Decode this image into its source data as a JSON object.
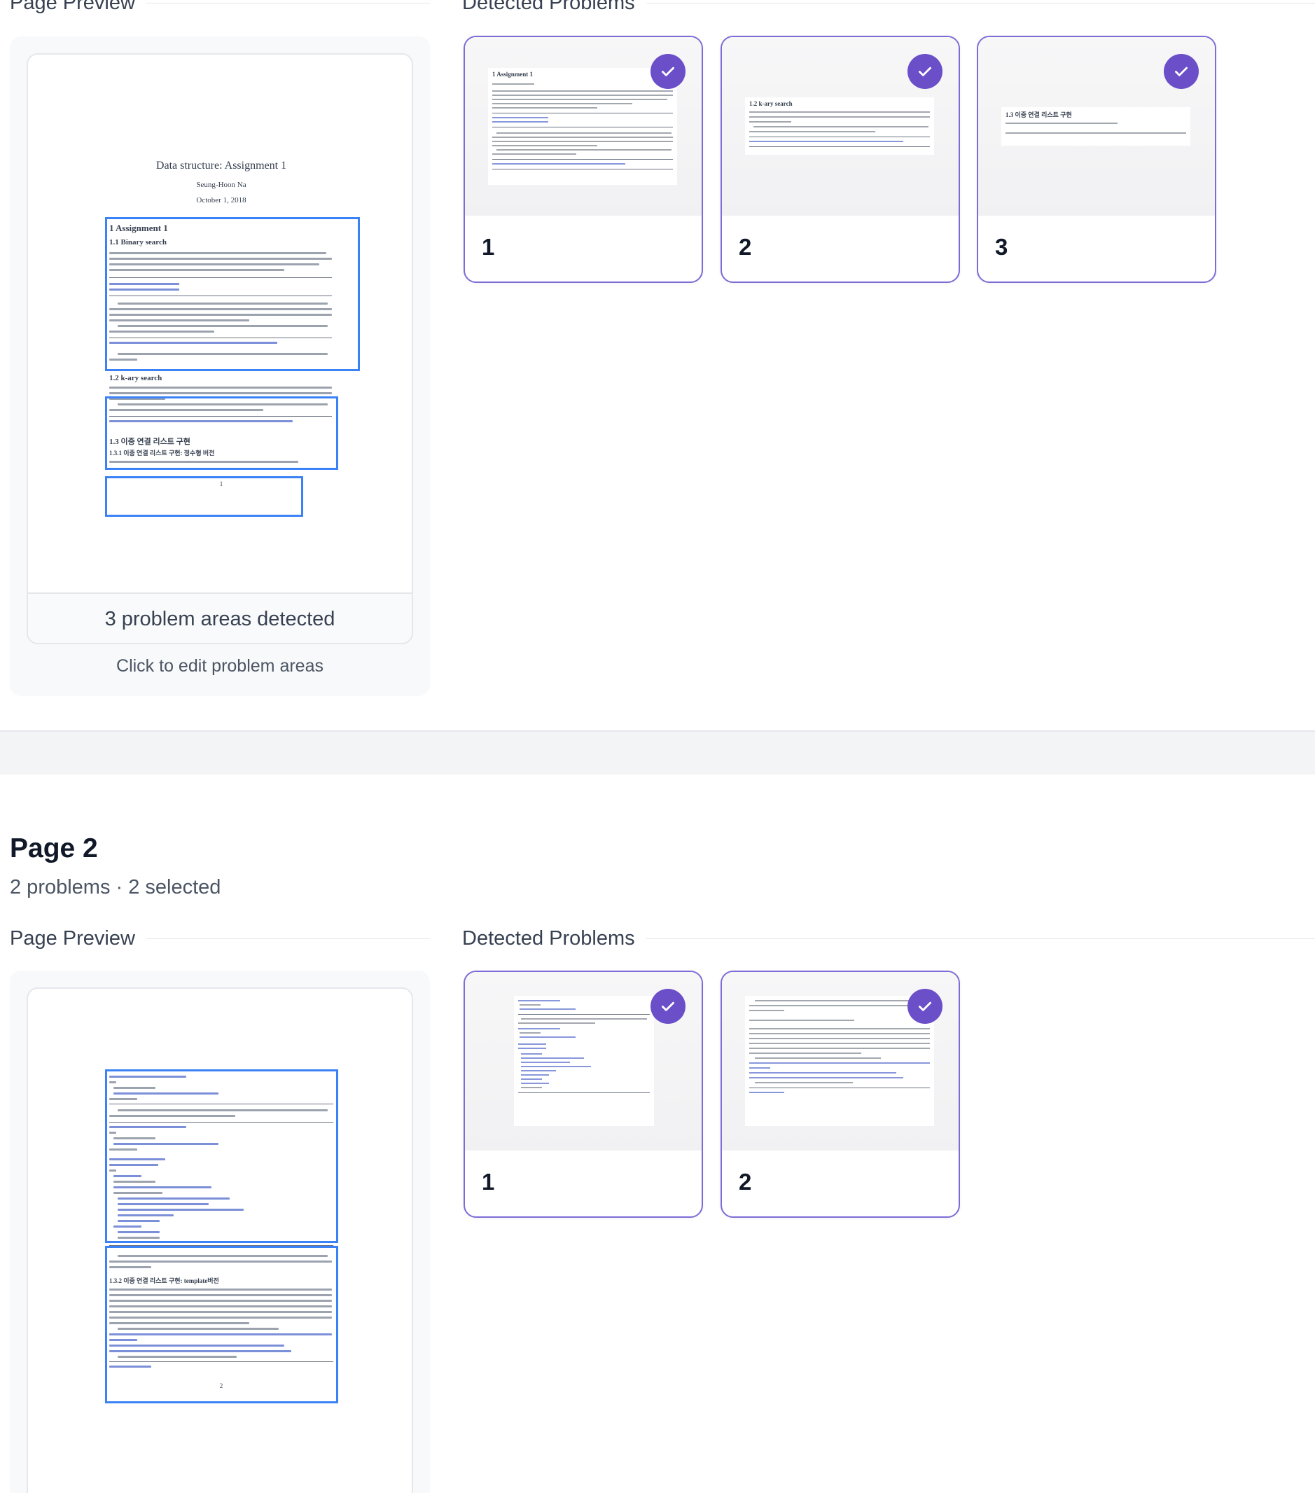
{
  "section1": {
    "page_preview_label": "Page Preview",
    "detected_problems_label": "Detected Problems",
    "doc": {
      "title": "Data structure: Assignment 1",
      "author": "Seung-Hoon Na",
      "date": "October 1, 2018",
      "h1": "1   Assignment 1",
      "h11": "1.1   Binary search",
      "h12": "1.2   k-ary search",
      "h13": "1.3   이중 연결 리스트 구현",
      "h131": "1.3.1   이중 연결 리스트 구현: 정수형 버전",
      "page_number": "1"
    },
    "footer_text": "3 problem areas detected",
    "edit_link": "Click to edit problem areas",
    "problems": [
      {
        "number": "1",
        "selected": true,
        "heading": "1   Assignment 1"
      },
      {
        "number": "2",
        "selected": true,
        "heading": "1.2   k-ary search"
      },
      {
        "number": "3",
        "selected": true,
        "heading": "1.3   이중 연결 리스트 구현"
      }
    ]
  },
  "page2": {
    "title": "Page 2",
    "subtitle": "2 problems · 2 selected",
    "page_preview_label": "Page Preview",
    "detected_problems_label": "Detected Problems",
    "doc": {
      "h132": "1.3.2   이중 연결 리스트 구현: template버전",
      "page_number": "2"
    },
    "problems": [
      {
        "number": "1",
        "selected": true
      },
      {
        "number": "2",
        "selected": true
      }
    ]
  },
  "colors": {
    "accent": "#6b4fc9",
    "card_border": "#7c6cd6",
    "highlight": "#3b82f6"
  }
}
